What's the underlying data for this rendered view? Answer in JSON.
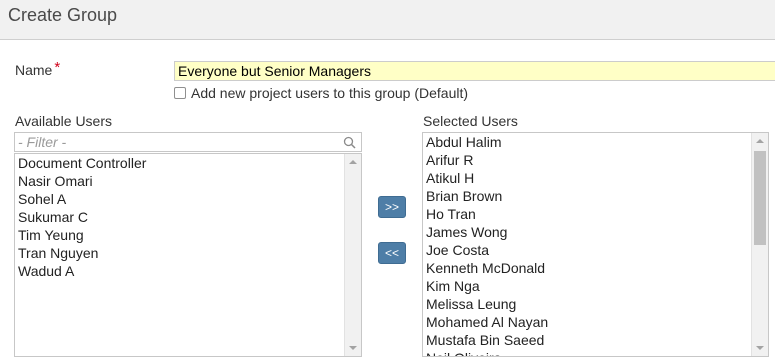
{
  "header": {
    "title": "Create Group"
  },
  "form": {
    "name_label": "Name",
    "required_marker": "*",
    "name_value": "Everyone but Senior Managers",
    "checkbox_label": "Add new project users to this group (Default)",
    "checkbox_checked": false
  },
  "available": {
    "label": "Available Users",
    "filter_placeholder": "- Filter -",
    "items": [
      "Document Controller",
      "Nasir Omari",
      "Sohel A",
      "Sukumar C",
      "Tim Yeung",
      "Tran Nguyen",
      "Wadud A"
    ]
  },
  "selected": {
    "label": "Selected Users",
    "items": [
      "Abdul Halim",
      "Arifur R",
      "Atikul H",
      "Brian Brown",
      "Ho Tran",
      "James Wong",
      "Joe Costa",
      "Kenneth McDonald",
      "Kim Nga",
      "Melissa Leung",
      "Mohamed Al Nayan",
      "Mustafa Bin Saeed",
      "Neil Oliveira"
    ]
  },
  "buttons": {
    "add_label": ">>",
    "remove_label": "<<"
  },
  "icons": {
    "search": "search-icon"
  }
}
